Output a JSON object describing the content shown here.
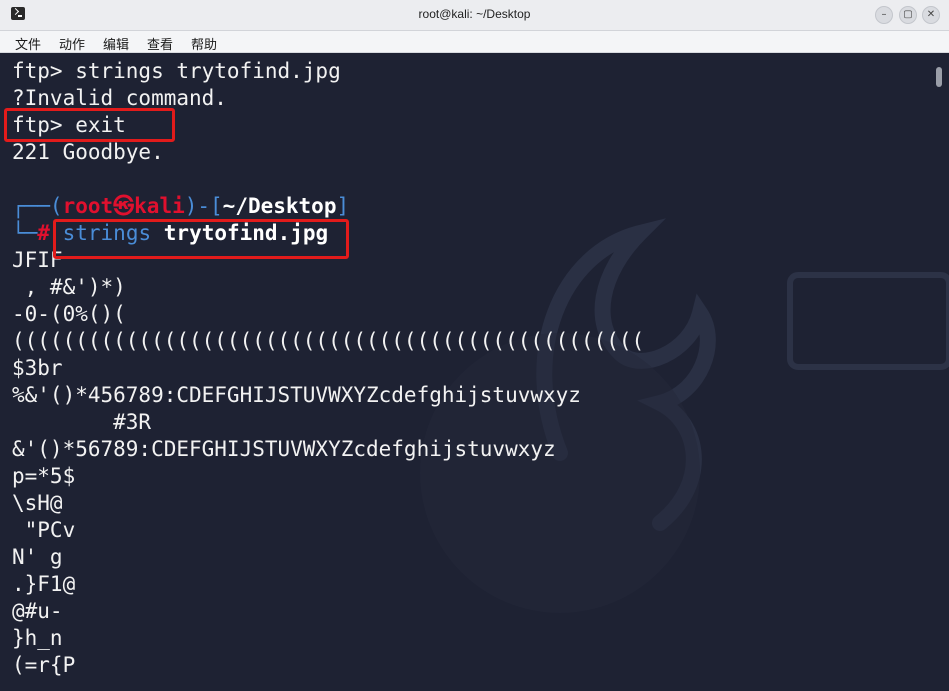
{
  "window": {
    "title": "root@kali: ~/Desktop",
    "min_glyph": "–",
    "max_glyph": "▢",
    "close_glyph": "✕"
  },
  "menu": {
    "items": [
      "文件",
      "动作",
      "编辑",
      "查看",
      "帮助"
    ]
  },
  "terminal": {
    "lines_before": [
      "ftp> strings trytofind.jpg",
      "?Invalid command.",
      "ftp> exit",
      "221 Goodbye."
    ],
    "prompt": {
      "top_left": "┌──(",
      "user": "root",
      "at": "㉿",
      "host": "kali",
      "mid": ")-[",
      "path": "~/Desktop",
      "end": "]",
      "bottom_left": "└─",
      "hash": "#",
      "command": "strings",
      "argument": "trytofind.jpg"
    },
    "output": [
      "JFIF",
      " , #&')*)",
      "-0-(0%()(",
      "((((((((((((((((((((((((((((((((((((((((((((((((((",
      "$3br",
      "%&'()*456789:CDEFGHIJSTUVWXYZcdefghijstuvwxyz",
      "        #3R",
      "&'()*56789:CDEFGHIJSTUVWXYZcdefghijstuvwxyz",
      "p=*5$",
      "\\sH@",
      " \"PCv",
      "N' g",
      ".}F1@",
      "@#u-",
      "}h_n",
      "(=r{P"
    ]
  },
  "colors": {
    "terminal_bg": "#1e2233",
    "text": "#f2f2f2",
    "prompt_blue": "#4a8dd8",
    "prompt_red": "#e0102e",
    "highlight_red": "#e21b1b"
  }
}
